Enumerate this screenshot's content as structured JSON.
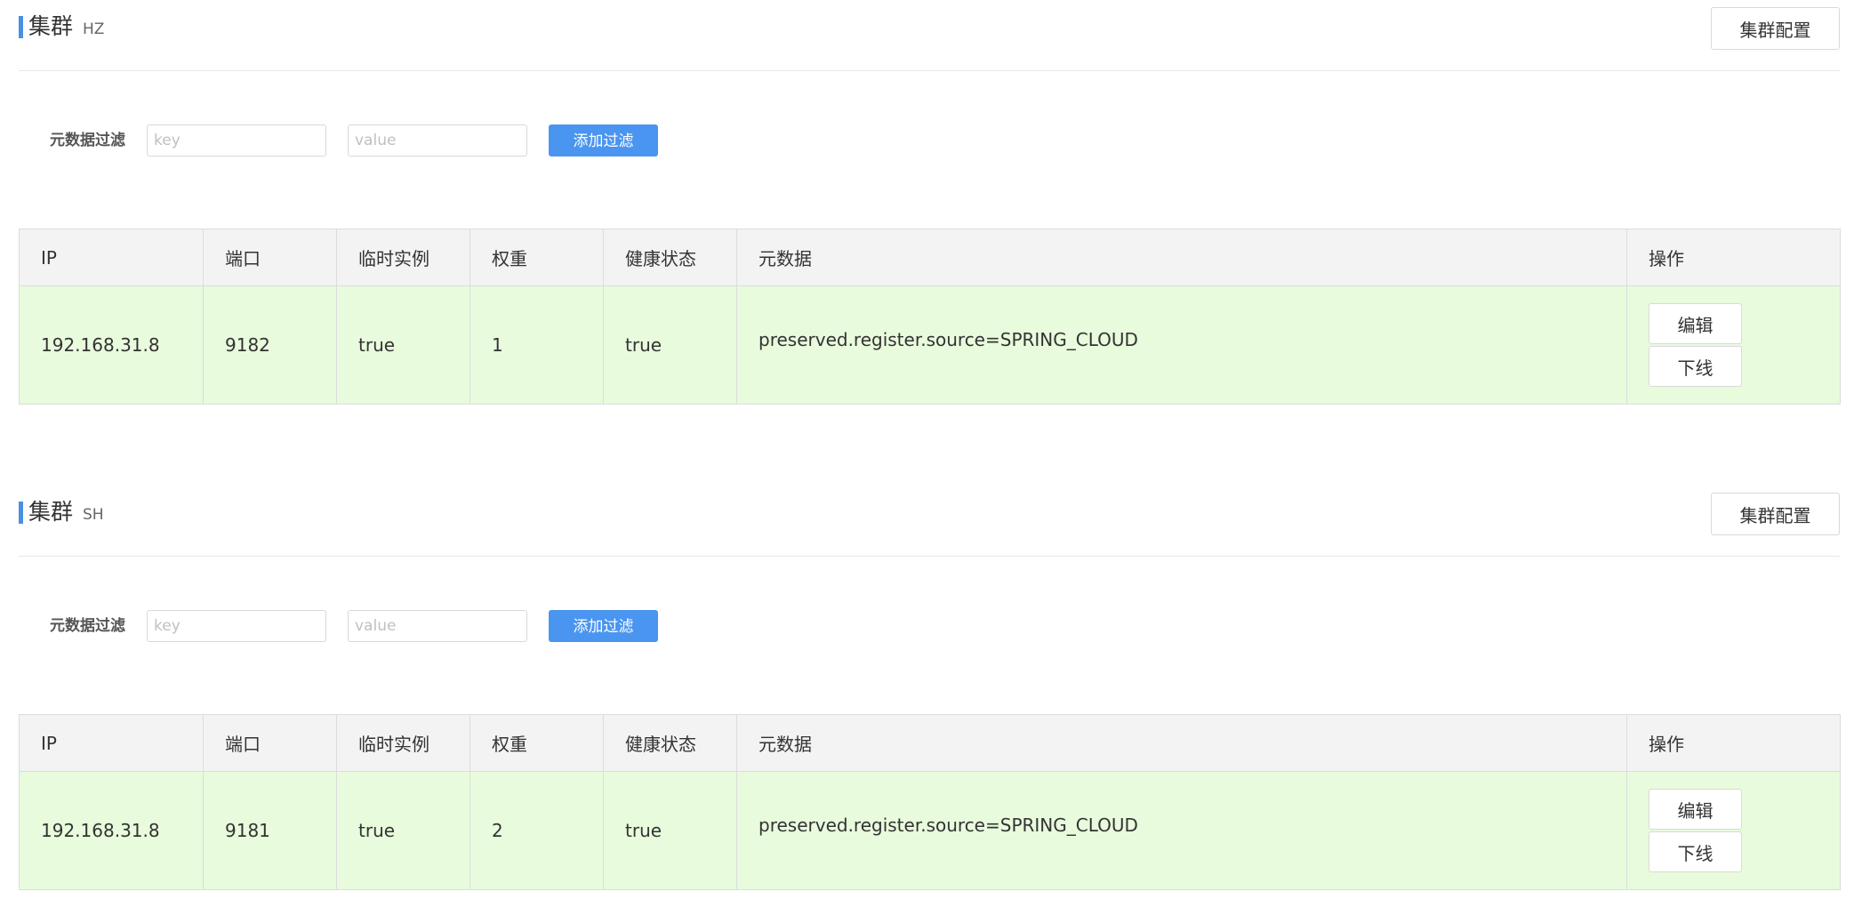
{
  "clusters": [
    {
      "title": "集群",
      "name": "HZ",
      "config_label": "集群配置",
      "filter": {
        "label": "元数据过滤",
        "key_placeholder": "key",
        "value_placeholder": "value",
        "add_label": "添加过滤"
      },
      "columns": [
        "IP",
        "端口",
        "临时实例",
        "权重",
        "健康状态",
        "元数据",
        "操作"
      ],
      "rows": [
        {
          "ip": "192.168.31.8",
          "port": "9182",
          "ephemeral": "true",
          "weight": "1",
          "healthy": "true",
          "metadata": "preserved.register.source=SPRING_CLOUD",
          "edit_label": "编辑",
          "offline_label": "下线"
        }
      ]
    },
    {
      "title": "集群",
      "name": "SH",
      "config_label": "集群配置",
      "filter": {
        "label": "元数据过滤",
        "key_placeholder": "key",
        "value_placeholder": "value",
        "add_label": "添加过滤"
      },
      "columns": [
        "IP",
        "端口",
        "临时实例",
        "权重",
        "健康状态",
        "元数据",
        "操作"
      ],
      "rows": [
        {
          "ip": "192.168.31.8",
          "port": "9181",
          "ephemeral": "true",
          "weight": "2",
          "healthy": "true",
          "metadata": "preserved.register.source=SPRING_CLOUD",
          "edit_label": "编辑",
          "offline_label": "下线"
        }
      ]
    }
  ],
  "colors": {
    "accent": "#4a90e2",
    "button_primary": "#4a95ef",
    "row_success": "#e8fbdc",
    "header_bg": "#f3f3f3"
  }
}
